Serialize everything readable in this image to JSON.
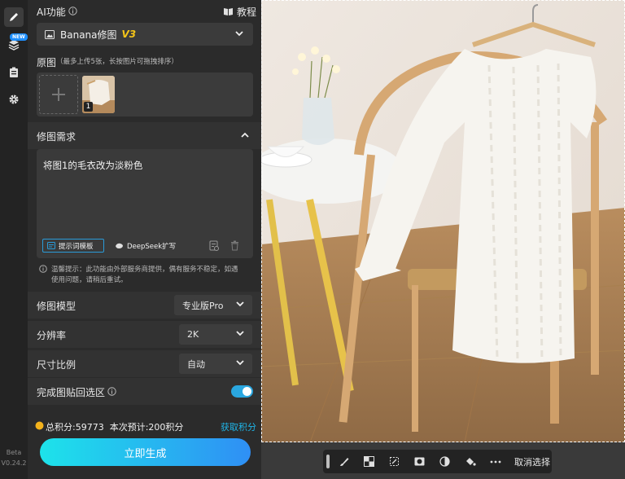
{
  "rail": {
    "new_badge": "NEW",
    "version_label": "Beta",
    "version": "V0.24.2"
  },
  "header": {
    "title": "AI功能",
    "tutorial": "教程"
  },
  "model_select": {
    "name": "Banana修图",
    "version_tag": "V3"
  },
  "originals": {
    "label": "原图",
    "hint": "（最多上传5张，长按图片可拖拽排序）",
    "thumb_index": "1"
  },
  "edit_request": {
    "label": "修图需求",
    "text": "将图1的毛衣改为淡粉色",
    "template_button": "提示词模板",
    "deepseek_button": "DeepSeek扩写",
    "notice_line1": "温馨提示：此功能由外部服务商提供，偶有服务不稳定，如遇",
    "notice_line2": "使用问题，请稍后重试。"
  },
  "settings": {
    "model_label": "修图模型",
    "model_value": "专业版Pro",
    "resolution_label": "分辨率",
    "resolution_value": "2K",
    "ratio_label": "尺寸比例",
    "ratio_value": "自动",
    "paste_back_label": "完成图贴回选区",
    "paste_back_on": true
  },
  "footer": {
    "points_text": "总积分:59773  本次预计:200积分",
    "get_points": "获取积分",
    "generate": "立即生成"
  },
  "toolbar": {
    "deselect": "取消选择"
  },
  "colors": {
    "accent": "#1fb5e8",
    "toggle": "#2aa7e0",
    "generate_gradient_start": "#1de3ea",
    "generate_gradient_end": "#2f8ff5",
    "coin": "#f3b21c"
  }
}
